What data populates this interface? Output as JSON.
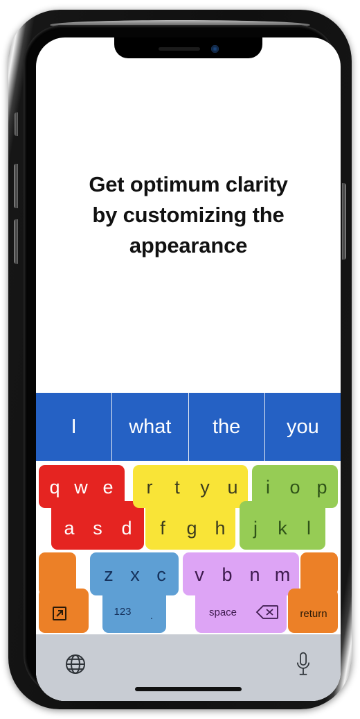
{
  "device": {
    "name": "iphone-x",
    "notch": {
      "speaker": "speaker-grille",
      "camera": "front-camera"
    },
    "buttons": [
      "mute-switch",
      "volume-up",
      "volume-down",
      "power"
    ],
    "home_indicator": "home-indicator"
  },
  "headline": {
    "line1": "Get optimum clarity",
    "line2": "by customizing the",
    "line3": "appearance"
  },
  "keyboard": {
    "prediction_bar": {
      "bg_color": "#2561c4",
      "text_color": "#ffffff",
      "suggestions": [
        "I",
        "what",
        "the",
        "you"
      ]
    },
    "colors": {
      "red": "#e52421",
      "yellow": "#f9e437",
      "green": "#96cc55",
      "orange": "#ec8027",
      "blue": "#5e9fd4",
      "purple": "#dda4f5",
      "toolbar": "#c8ccd3"
    },
    "blocks": [
      {
        "name": "red-block",
        "color": "#e52421",
        "text_color": "#ffffff",
        "top_keys": [
          "q",
          "w",
          "e"
        ],
        "bottom_keys": [
          "a",
          "s",
          "d"
        ]
      },
      {
        "name": "yellow-block",
        "color": "#f9e437",
        "text_color": "#3c3c1e",
        "top_keys": [
          "r",
          "t",
          "y",
          "u"
        ],
        "bottom_keys": [
          "f",
          "g",
          "h"
        ]
      },
      {
        "name": "green-block",
        "color": "#96cc55",
        "text_color": "#2f5318",
        "top_keys": [
          "i",
          "o",
          "p"
        ],
        "bottom_keys": [
          "j",
          "k",
          "l"
        ]
      },
      {
        "name": "blue-block",
        "color": "#5e9fd4",
        "text_color": "#16325c",
        "top_keys": [
          "z",
          "x",
          "c"
        ],
        "bottom_keys": [
          "123",
          "."
        ]
      },
      {
        "name": "purple-block",
        "color": "#dda4f5",
        "text_color": "#3d1a4d",
        "top_keys": [
          "v",
          "b",
          "n",
          "m"
        ],
        "bottom_keys": [
          "space",
          "backspace-icon"
        ]
      }
    ],
    "special_keys": {
      "expand": {
        "name": "expand-icon",
        "color": "#ec8027",
        "label": ""
      },
      "return": {
        "name": "return-key",
        "color": "#ec8027",
        "label": "return",
        "text_color": "#2b1a08"
      },
      "numbers": {
        "label": "123"
      },
      "period": {
        "label": "."
      },
      "space": {
        "label": "space"
      },
      "backspace": {
        "name": "backspace-icon",
        "label": "⌫"
      }
    },
    "toolbar": {
      "bg_color": "#c8ccd3",
      "globe": "globe-icon",
      "microphone": "microphone-icon"
    }
  }
}
